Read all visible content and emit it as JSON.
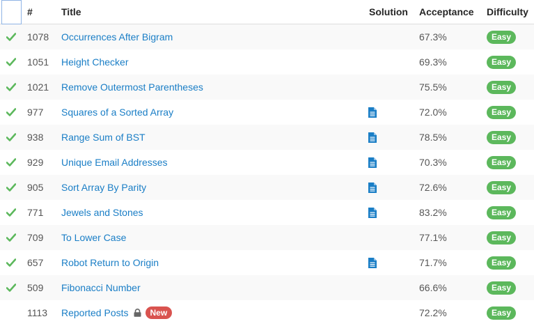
{
  "headers": {
    "num": "#",
    "title": "Title",
    "solution": "Solution",
    "acceptance": "Acceptance",
    "difficulty": "Difficulty"
  },
  "colors": {
    "link": "#1a7ec6",
    "check": "#5cb85c",
    "easy": "#5cb85c",
    "new": "#d9534f",
    "solution_icon": "#1a7ec6"
  },
  "rows": [
    {
      "num": "1078",
      "title": "Occurrences After Bigram",
      "acceptance": "67.3%",
      "difficulty": "Easy"
    },
    {
      "num": "1051",
      "title": "Height Checker",
      "acceptance": "69.3%",
      "difficulty": "Easy"
    },
    {
      "num": "1021",
      "title": "Remove Outermost Parentheses",
      "acceptance": "75.5%",
      "difficulty": "Easy"
    },
    {
      "num": "977",
      "title": "Squares of a Sorted Array",
      "acceptance": "72.0%",
      "difficulty": "Easy"
    },
    {
      "num": "938",
      "title": "Range Sum of BST",
      "acceptance": "78.5%",
      "difficulty": "Easy"
    },
    {
      "num": "929",
      "title": "Unique Email Addresses",
      "acceptance": "70.3%",
      "difficulty": "Easy"
    },
    {
      "num": "905",
      "title": "Sort Array By Parity",
      "acceptance": "72.6%",
      "difficulty": "Easy"
    },
    {
      "num": "771",
      "title": "Jewels and Stones",
      "acceptance": "83.2%",
      "difficulty": "Easy"
    },
    {
      "num": "709",
      "title": "To Lower Case",
      "acceptance": "77.1%",
      "difficulty": "Easy"
    },
    {
      "num": "657",
      "title": "Robot Return to Origin",
      "acceptance": "71.7%",
      "difficulty": "Easy"
    },
    {
      "num": "509",
      "title": "Fibonacci Number",
      "acceptance": "66.6%",
      "difficulty": "Easy"
    },
    {
      "num": "1113",
      "title": "Reported Posts",
      "badge": "New",
      "acceptance": "72.2%",
      "difficulty": "Easy"
    }
  ]
}
